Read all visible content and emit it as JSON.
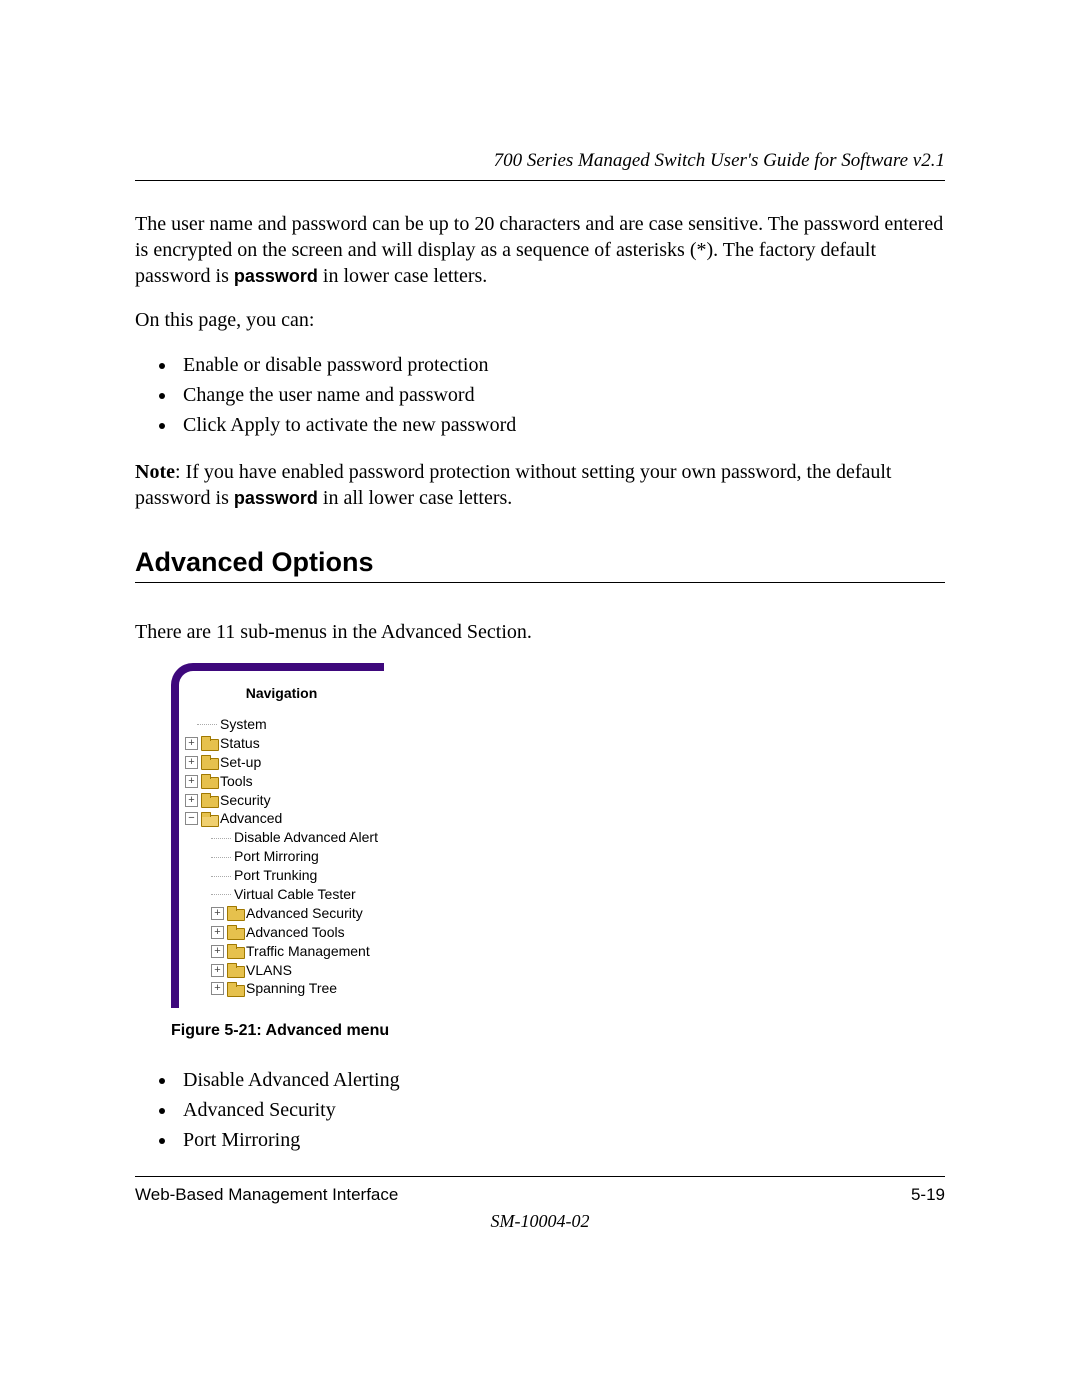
{
  "header": {
    "title": "700 Series Managed Switch User's Guide for Software v2.1"
  },
  "paragraphs": {
    "p1_pre": "The user name and password can be up to 20 characters and are case sensitive.  The password entered is encrypted on the screen and will display as a sequence of asterisks (*). The factory default password is ",
    "p1_bold": "password",
    "p1_post": " in lower case letters.",
    "p2": "On this page, you can:",
    "note_label": "Note",
    "note_pre": ": If you have enabled password protection without setting your own password, the default password is ",
    "note_bold": "password",
    "note_post": " in all lower case letters.",
    "advanced_intro": "There are 11 sub-menus in the Advanced Section."
  },
  "bullets_top": [
    "Enable or disable password protection",
    "Change the user name and password",
    "Click Apply to activate the new password"
  ],
  "section_heading": "Advanced Options",
  "nav": {
    "title": "Navigation",
    "system": "System",
    "status": "Status",
    "setup": "Set-up",
    "tools": "Tools",
    "security": "Security",
    "advanced": "Advanced",
    "items": {
      "disable_alert": "Disable Advanced Alert",
      "port_mirroring": "Port Mirroring",
      "port_trunking": "Port Trunking",
      "vct": "Virtual Cable Tester",
      "adv_security": "Advanced Security",
      "adv_tools": "Advanced Tools",
      "traffic_mgmt": "Traffic Management",
      "vlans": "VLANS",
      "spanning_tree": "Spanning Tree"
    }
  },
  "figure_caption": "Figure 5-21:  Advanced menu",
  "bullets_bottom": [
    "Disable Advanced Alerting",
    "Advanced Security",
    "Port Mirroring"
  ],
  "footer": {
    "left": "Web-Based Management Interface",
    "right": "5-19",
    "docnum": "SM-10004-02"
  }
}
